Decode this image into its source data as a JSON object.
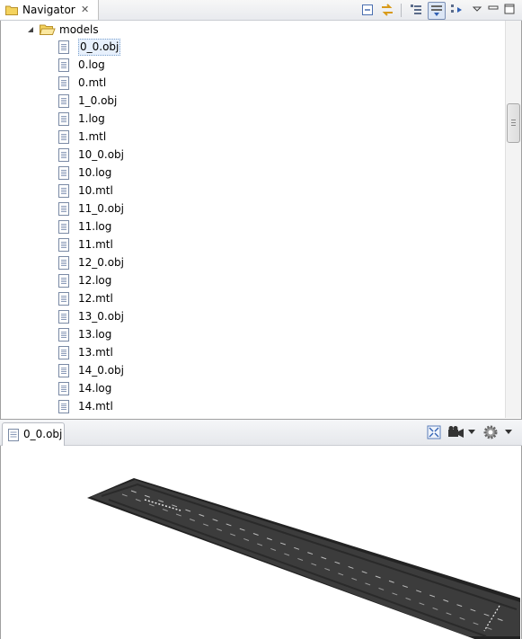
{
  "navigator": {
    "title": "Navigator",
    "close_glyph": "✕",
    "toolbar_icons": [
      "collapse-all-icon",
      "link-with-editor-icon",
      "tree-layout-icon",
      "filter-icon",
      "view-menu-icon",
      "minimize-icon",
      "maximize-icon"
    ],
    "folder": {
      "name": "models",
      "expanded": true
    },
    "files": [
      "0_0.obj",
      "0.log",
      "0.mtl",
      "1_0.obj",
      "1.log",
      "1.mtl",
      "10_0.obj",
      "10.log",
      "10.mtl",
      "11_0.obj",
      "11.log",
      "11.mtl",
      "12_0.obj",
      "12.log",
      "12.mtl",
      "13_0.obj",
      "13.log",
      "13.mtl",
      "14_0.obj",
      "14.log",
      "14.mtl"
    ],
    "selected_file": "0_0.obj"
  },
  "viewer": {
    "tab_title": "0_0.obj",
    "toolbar_icons": [
      "fit-to-view-icon",
      "camera-icon",
      "camera-dropdown-icon",
      "settings-gear-icon",
      "settings-dropdown-icon"
    ],
    "model": "road-segment",
    "colors": {
      "asphalt": "#3a3a3a",
      "edge": "#1e1e1e",
      "lane_marking": "#d8d8d8"
    }
  }
}
